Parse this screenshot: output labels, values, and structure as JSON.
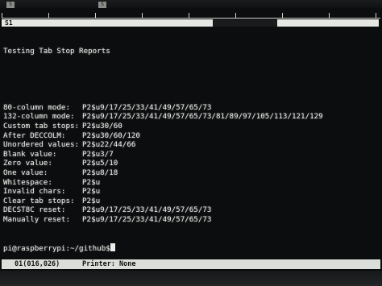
{
  "top_marker": "S1",
  "corner_marks": [
    "S",
    "S"
  ],
  "heading": "Testing Tab Stop Reports",
  "report_lines": [
    {
      "label": "80-column mode:",
      "value": "P2$u9/17/25/33/41/49/57/65/73"
    },
    {
      "label": "132-column mode:",
      "value": "P2$u9/17/25/33/41/49/57/65/73/81/89/97/105/113/121/129"
    },
    {
      "label": "Custom tab stops:",
      "value": "P2$u30/60"
    },
    {
      "label": "After DECCOLM:",
      "value": "P2$u30/60/120"
    },
    {
      "label": "Unordered values:",
      "value": "P2$u22/44/66"
    },
    {
      "label": "Blank value:",
      "value": "P2$u3/7"
    },
    {
      "label": "Zero value:",
      "value": "P2$u5/10"
    },
    {
      "label": "One value:",
      "value": "P2$u8/18"
    },
    {
      "label": "Whitespace:",
      "value": "P2$u"
    },
    {
      "label": "Invalid chars:",
      "value": "P2$u"
    },
    {
      "label": "Clear tab stops:",
      "value": "P2$u"
    },
    {
      "label": "DECST8C reset:",
      "value": "P2$u9/17/25/33/41/49/57/65/73"
    },
    {
      "label": "Manually reset:",
      "value": "P2$u9/17/25/33/41/49/57/65/73"
    }
  ],
  "prompt": "pi@raspberrypi:~/github$",
  "status_bar": {
    "cursor_position": "01(016,026)",
    "printer": "Printer: None"
  },
  "colors": {
    "screen_background": "#0c0d0f",
    "text": "#ecefe9",
    "status_bar": "#dcdfd9"
  }
}
